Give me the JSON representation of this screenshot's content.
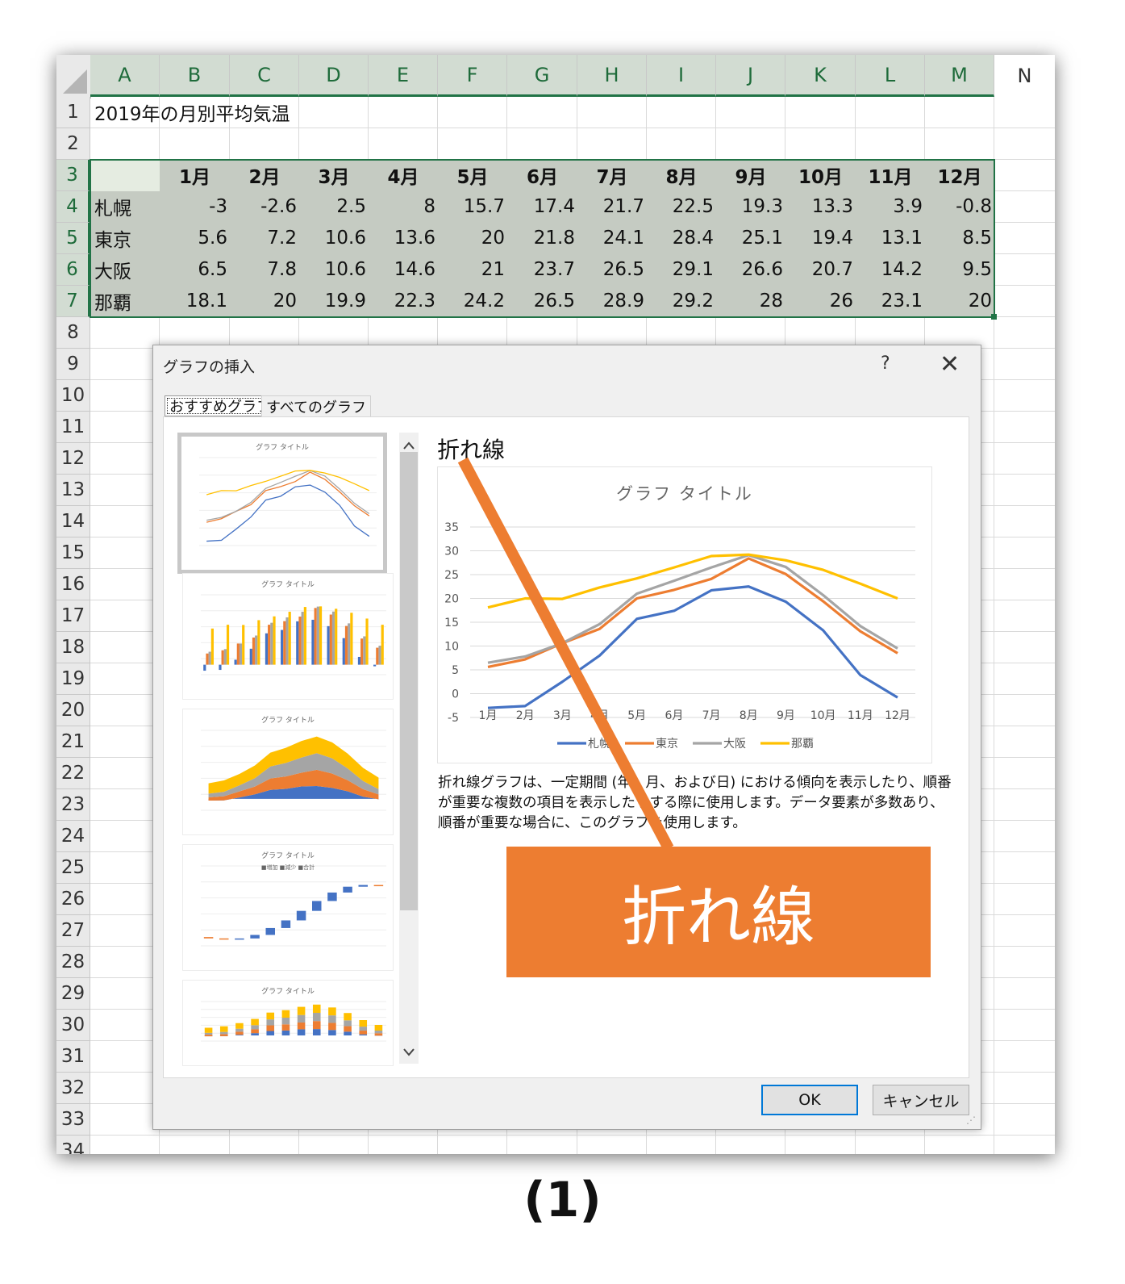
{
  "sheet": {
    "columns": [
      "A",
      "B",
      "C",
      "D",
      "E",
      "F",
      "G",
      "H",
      "I",
      "J",
      "K",
      "L",
      "M",
      "N"
    ],
    "rows": [
      "1",
      "2",
      "3",
      "4",
      "5",
      "6",
      "7",
      "8",
      "9",
      "10",
      "11",
      "12",
      "13",
      "14",
      "15",
      "16",
      "17",
      "18",
      "19",
      "20",
      "21",
      "22",
      "23",
      "24",
      "25",
      "26",
      "27",
      "28",
      "29",
      "30",
      "31",
      "32",
      "33",
      "34"
    ],
    "title_cell": "2019年の月別平均気温",
    "months": [
      "1月",
      "2月",
      "3月",
      "4月",
      "5月",
      "6月",
      "7月",
      "8月",
      "9月",
      "10月",
      "11月",
      "12月"
    ],
    "cities": [
      {
        "name": "札幌",
        "values": [
          "-3",
          "-2.6",
          "2.5",
          "8",
          "15.7",
          "17.4",
          "21.7",
          "22.5",
          "19.3",
          "13.3",
          "3.9",
          "-0.8"
        ]
      },
      {
        "name": "東京",
        "values": [
          "5.6",
          "7.2",
          "10.6",
          "13.6",
          "20",
          "21.8",
          "24.1",
          "28.4",
          "25.1",
          "19.4",
          "13.1",
          "8.5"
        ]
      },
      {
        "name": "大阪",
        "values": [
          "6.5",
          "7.8",
          "10.6",
          "14.6",
          "21",
          "23.7",
          "26.5",
          "29.1",
          "26.6",
          "20.7",
          "14.2",
          "9.5"
        ]
      },
      {
        "name": "那覇",
        "values": [
          "18.1",
          "20",
          "19.9",
          "22.3",
          "24.2",
          "26.5",
          "28.9",
          "29.2",
          "28",
          "26",
          "23.1",
          "20"
        ]
      }
    ]
  },
  "dialog": {
    "title": "グラフの挿入",
    "help": "?",
    "close": "✕",
    "tabs": [
      "おすすめグラフ",
      "すべてのグラフ"
    ],
    "chart_type_name": "折れ線",
    "description": "折れ線グラフは、一定期間 (年、月、および日) における傾向を表示したり、順番が重要な複数の項目を表示したりする際に使用します。データ要素が多数あり、順番が重要な場合に、このグラフを使用します。",
    "ok_label": "OK",
    "cancel_label": "キャンセル",
    "scroll_up": "^",
    "scroll_down": "v",
    "thumbnail_title": "グラフ タイトル",
    "thumbnail_legend_waterfall": [
      "増加",
      "減少",
      "合計"
    ]
  },
  "chart_data": {
    "type": "line",
    "title": "グラフ タイトル",
    "categories": [
      "1月",
      "2月",
      "3月",
      "4月",
      "5月",
      "6月",
      "7月",
      "8月",
      "9月",
      "10月",
      "11月",
      "12月"
    ],
    "ylim": [
      -5,
      35
    ],
    "yticks": [
      "35",
      "30",
      "25",
      "20",
      "15",
      "10",
      "5",
      "0",
      "-5"
    ],
    "grid": true,
    "legend_position": "bottom",
    "series": [
      {
        "name": "札幌",
        "color": "#4472c4",
        "values": [
          -3,
          -2.6,
          2.5,
          8,
          15.7,
          17.4,
          21.7,
          22.5,
          19.3,
          13.3,
          3.9,
          -0.8
        ]
      },
      {
        "name": "東京",
        "color": "#ed7d31",
        "values": [
          5.6,
          7.2,
          10.6,
          13.6,
          20,
          21.8,
          24.1,
          28.4,
          25.1,
          19.4,
          13.1,
          8.5
        ]
      },
      {
        "name": "大阪",
        "color": "#a5a5a5",
        "values": [
          6.5,
          7.8,
          10.6,
          14.6,
          21,
          23.7,
          26.5,
          29.1,
          26.6,
          20.7,
          14.2,
          9.5
        ]
      },
      {
        "name": "那覇",
        "color": "#ffc000",
        "values": [
          18.1,
          20,
          19.9,
          22.3,
          24.2,
          26.5,
          28.9,
          29.2,
          28,
          26,
          23.1,
          20
        ]
      }
    ]
  },
  "annotation": {
    "callout_text": "折れ線",
    "color": "#ed7d31",
    "caption": "(1)"
  },
  "colors": {
    "excel_green": "#217346",
    "table_fill": "#c5cbc2",
    "ok_border": "#0078d7"
  }
}
